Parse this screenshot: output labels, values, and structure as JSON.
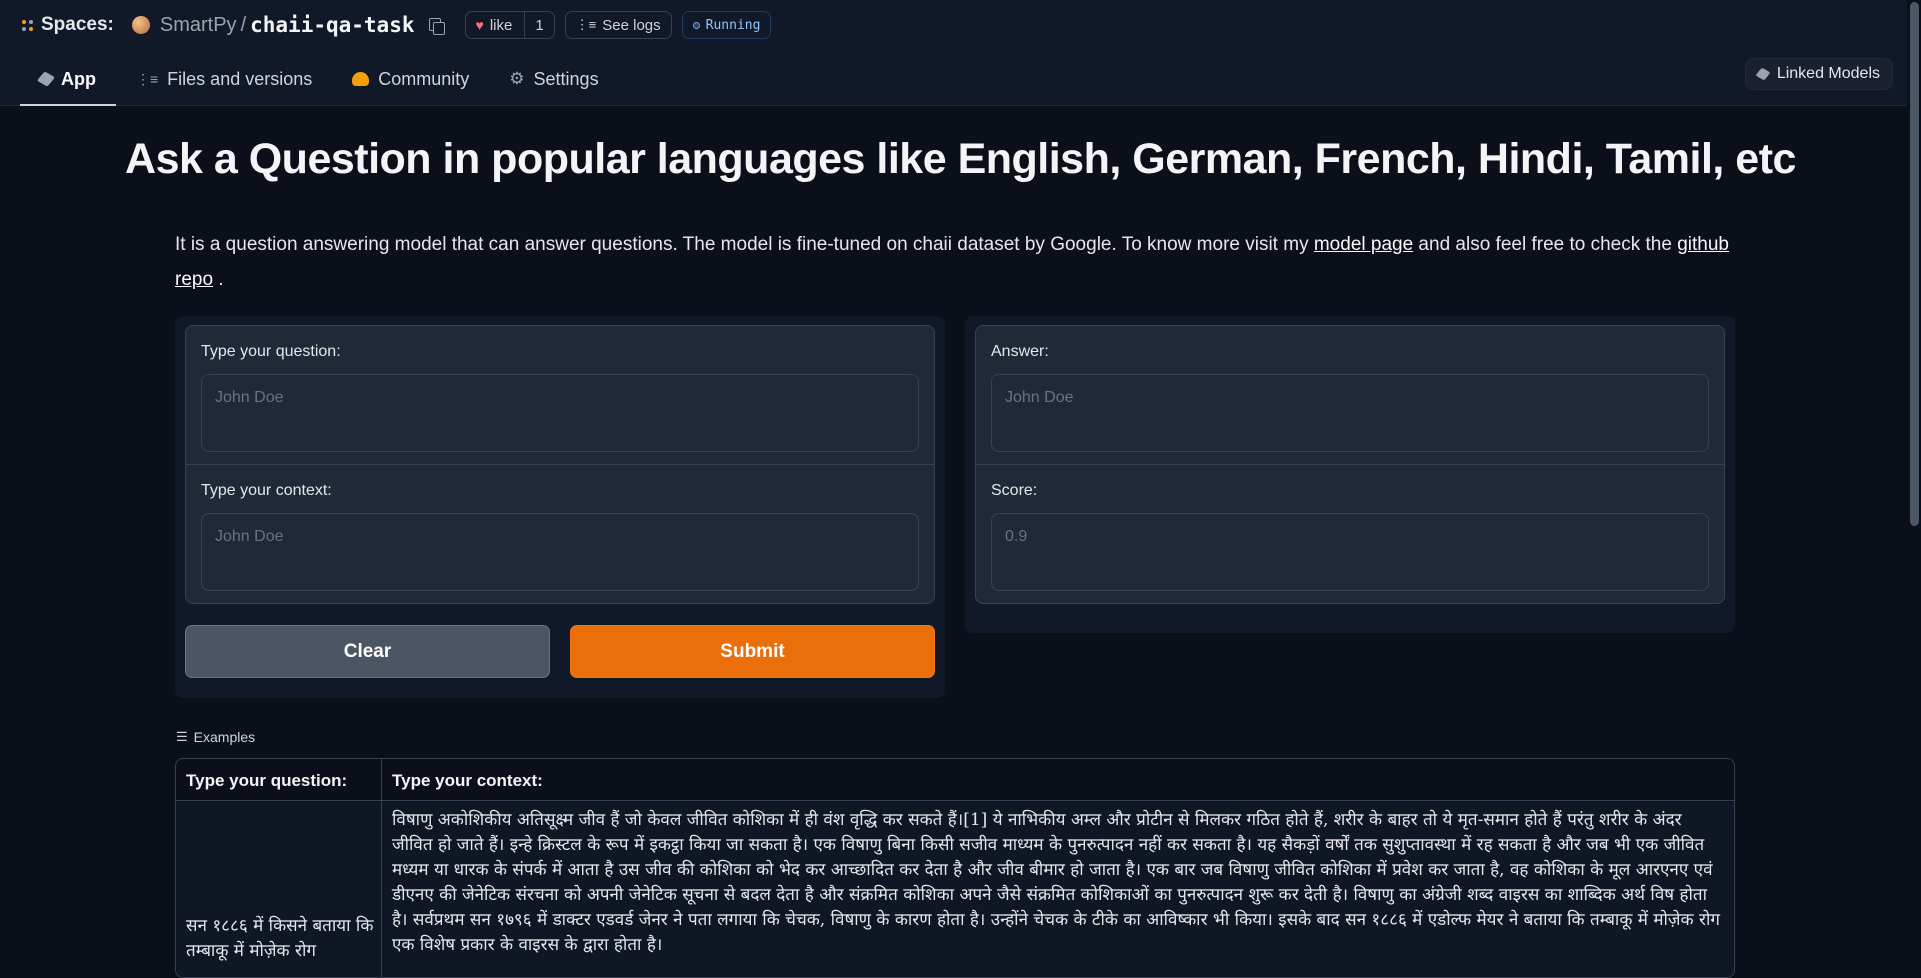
{
  "header": {
    "spaces_label": "Spaces:",
    "owner": "SmartPy",
    "repo": "chaii-qa-task",
    "like_label": "like",
    "like_count": "1",
    "logs_label": "See logs",
    "status": "Running"
  },
  "tabs": [
    {
      "label": "App"
    },
    {
      "label": "Files and versions"
    },
    {
      "label": "Community"
    },
    {
      "label": "Settings"
    }
  ],
  "linked_models_label": "Linked Models",
  "page": {
    "title": "Ask a Question in popular languages like English, German, French, Hindi, Tamil, etc",
    "desc_prefix": "It is a question answering model that can answer questions. The model is fine-tuned on chaii dataset by Google. To know more visit my ",
    "desc_link1": "model page",
    "desc_middle": " and also feel free to check the ",
    "desc_link2": "github repo",
    "desc_suffix": " ."
  },
  "form": {
    "question_label": "Type your question:",
    "question_placeholder": "John Doe",
    "context_label": "Type your context:",
    "context_placeholder": "John Doe",
    "answer_label": "Answer:",
    "answer_placeholder": "John Doe",
    "score_label": "Score:",
    "score_placeholder": "0.9",
    "clear_label": "Clear",
    "submit_label": "Submit"
  },
  "examples": {
    "label": "Examples",
    "headers": [
      "Type your question:",
      "Type your context:"
    ],
    "row_question": "सन १८८६ में किसने बताया कि तम्बाकू में मोज़ेक रोग",
    "row_context": "विषाणु अकोशिकीय अतिसूक्ष्म जीव हैं जो केवल जीवित कोशिका में ही वंश वृद्धि कर सकते हैं।[1] ये नाभिकीय अम्ल और प्रोटीन से मिलकर गठित होते हैं, शरीर के बाहर तो ये मृत-समान होते हैं परंतु शरीर के अंदर जीवित हो जाते हैं। इन्हे क्रिस्टल के रूप में इकट्ठा किया जा सकता है। एक विषाणु बिना किसी सजीव माध्यम के पुनरुत्पादन नहीं कर सकता है। यह सैकड़ों वर्षों तक सुशुप्तावस्था में रह सकता है और जब भी एक जीवित मध्यम या धारक के संपर्क में आता है उस जीव की कोशिका को भेद कर आच्छादित कर देता है और जीव बीमार हो जाता है। एक बार जब विषाणु जीवित कोशिका में प्रवेश कर जाता है, वह कोशिका के मूल आरएनए एवं डीएनए की जेनेटिक संरचना को अपनी जेनेटिक सूचना से बदल देता है और संक्रमित कोशिका अपने जैसे संक्रमित कोशिकाओं का पुनरुत्पादन शुरू कर देती है। विषाणु का अंग्रेजी शब्द वाइरस का शाब्दिक अर्थ विष होता है। सर्वप्रथम सन १७९६ में डाक्टर एडवर्ड जेनर ने पता लगाया कि चेचक, विषाणु के कारण होता है। उन्होंने चेचक के टीके का आविष्कार भी किया। इसके बाद सन १८८६ में एडोल्फ मेयर ने बताया कि तम्बाकू में मोज़ेक रोग एक विशेष प्रकार के वाइरस के द्वारा होता है।"
  }
}
